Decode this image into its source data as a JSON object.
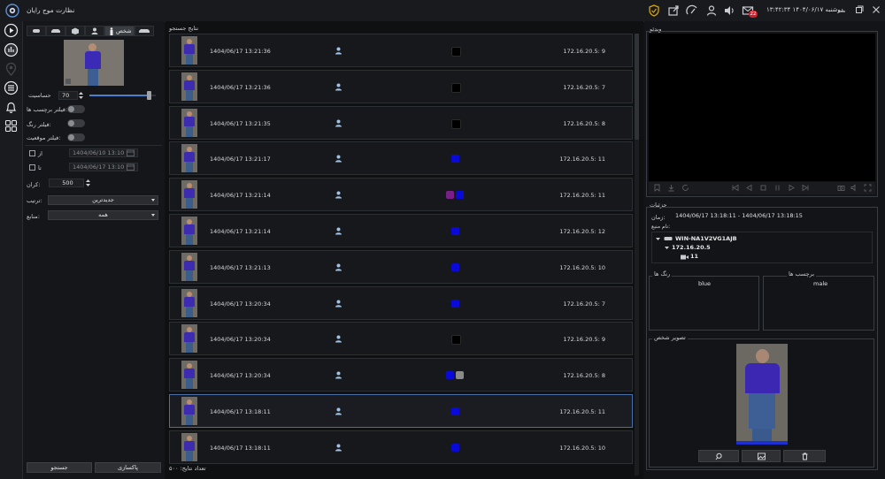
{
  "app": {
    "title": "نظارت موج رایان",
    "datetime": "دوشنبه ۱۴۰۴/۰۶/۱۷ ۱۳:۴۲:۳۴",
    "notification_count": "22"
  },
  "filter": {
    "tab_person": "شخص",
    "sensitivity_label": "حساسیت",
    "sensitivity_value": "70",
    "sensitivity_level": 0.9,
    "tag_filter_label": "فیلتر برچسب ها:",
    "color_filter_label": "فیلتر رنگ:",
    "location_filter_label": "فیلتر موقعیت:",
    "from_label": "از",
    "from_value": "1404/06/10  13:10",
    "to_label": "تا",
    "to_value": "1404/06/17  13:10",
    "limit_label": "کران:",
    "limit_value": "500",
    "sort_label": "ترتیب:",
    "sort_value": "جدیدترین",
    "source_label": "منابع:",
    "source_value": "همه",
    "search_button": "جستجو",
    "clear_button": "پاکسازی"
  },
  "results": {
    "header": "نتایج جستجو",
    "count_label": "تعداد نتایج: ۵۰۰",
    "rows": [
      {
        "time": "1404/06/17 13:21:36",
        "ip": "172.16.20.5: 9",
        "colors": [
          "#000000"
        ]
      },
      {
        "time": "1404/06/17 13:21:36",
        "ip": "172.16.20.5: 7",
        "colors": [
          "#000000"
        ]
      },
      {
        "time": "1404/06/17 13:21:35",
        "ip": "172.16.20.5: 8",
        "colors": [
          "#000000"
        ]
      },
      {
        "time": "1404/06/17 13:21:17",
        "ip": "172.16.20.5: 11",
        "colors": [
          "#0a0ad8"
        ]
      },
      {
        "time": "1404/06/17 13:21:14",
        "ip": "172.16.20.5: 11",
        "colors": [
          "#7a1f8a",
          "#0a0ad8"
        ]
      },
      {
        "time": "1404/06/17 13:21:14",
        "ip": "172.16.20.5: 12",
        "colors": [
          "#0a0ad8"
        ]
      },
      {
        "time": "1404/06/17 13:21:13",
        "ip": "172.16.20.5: 10",
        "colors": [
          "#0a0ad8"
        ]
      },
      {
        "time": "1404/06/17 13:20:34",
        "ip": "172.16.20.5: 7",
        "colors": [
          "#0a0ad8"
        ]
      },
      {
        "time": "1404/06/17 13:20:34",
        "ip": "172.16.20.5: 9",
        "colors": [
          "#000000"
        ]
      },
      {
        "time": "1404/06/17 13:20:34",
        "ip": "172.16.20.5: 8",
        "colors": [
          "#0a0ad8",
          "#8a8a8a"
        ]
      },
      {
        "time": "1404/06/17 13:18:11",
        "ip": "172.16.20.5: 11",
        "colors": [
          "#0a0ad8"
        ],
        "selected": true
      },
      {
        "time": "1404/06/17 13:18:11",
        "ip": "172.16.20.5: 10",
        "colors": [
          "#0a0ad8"
        ]
      }
    ]
  },
  "video": {
    "header": "ویدئو"
  },
  "details": {
    "header": "جزئیات",
    "time_label": "زمان:",
    "time_value": "1404/06/17 13:18:11 - 1404/06/17 13:18:15",
    "source_label": "نام منبع:",
    "tree_host": "WIN-NA1V2VG1AJB",
    "tree_ip": "172.16.20.5",
    "tree_cam": "11",
    "colors_header": "رنگ ها",
    "colors_value": "blue",
    "tags_header": "برچسب ها",
    "tags_value": "male",
    "image_header": "تصویر شخص"
  },
  "colors": {
    "accent_yellow": "#d9a400",
    "badge_red": "#d0202c",
    "selection_border": "#4a6fa8"
  },
  "icons": {
    "rail": [
      "play-icon",
      "chart-icon",
      "map-pin-icon",
      "list-icon",
      "bell-icon",
      "grid-icon"
    ],
    "titlebar": [
      "shield-icon",
      "export-icon",
      "speed-icon",
      "user-icon",
      "volume-icon",
      "mail-icon"
    ]
  }
}
